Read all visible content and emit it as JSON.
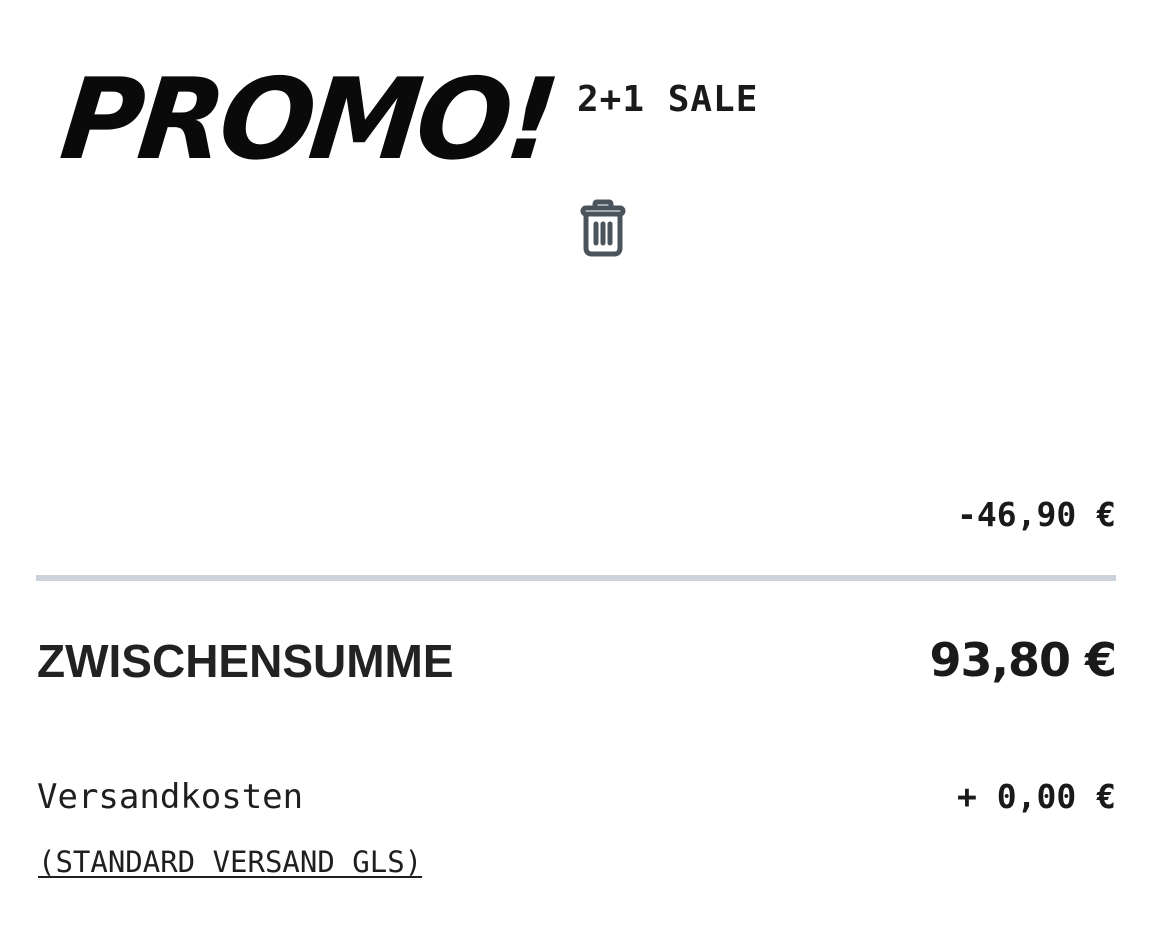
{
  "promo": {
    "logo_text": "PROMO!",
    "code_name": "2+1 SALE",
    "remove_icon": "trash-icon",
    "discount_amount": "-46,90 €"
  },
  "summary": {
    "subtotal_label": "ZWISCHENSUMME",
    "subtotal_value": "93,80 €",
    "shipping_label": "Versandkosten",
    "shipping_value": "+ 0,00 €",
    "shipping_method": "(STANDARD VERSAND GLS)"
  },
  "colors": {
    "text": "#1a1a1a",
    "divider": "#cdd3da",
    "icon": "#4a545c"
  }
}
